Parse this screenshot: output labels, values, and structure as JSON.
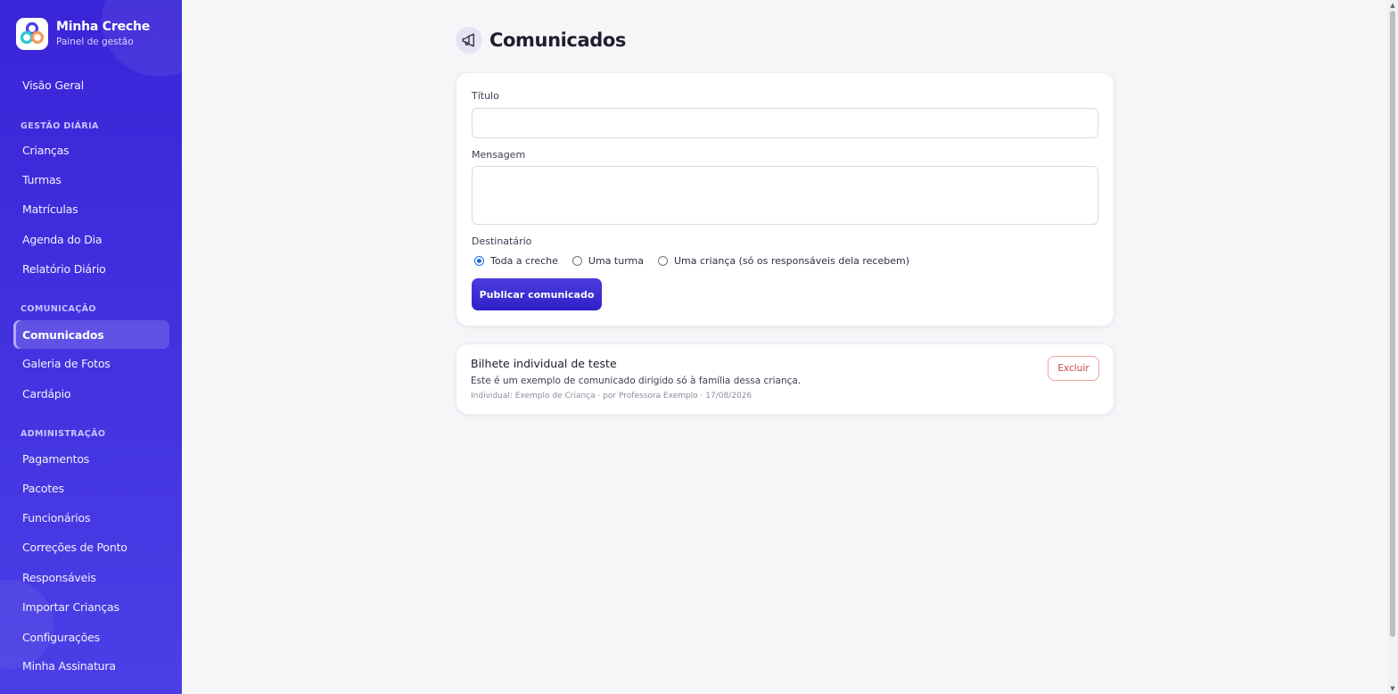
{
  "app": {
    "title": "Minha Creche",
    "subtitle": "Painel de gestão",
    "colors": {
      "sidebar": "#3a24d8",
      "accent": "#2f20c7",
      "danger": "#d2453a"
    }
  },
  "sidebar": {
    "overview": "Visão Geral",
    "sections": [
      {
        "title": "GESTÃO DIÁRIA",
        "items": [
          "Crianças",
          "Turmas",
          "Matrículas",
          "Agenda do Dia",
          "Relatório Diário"
        ]
      },
      {
        "title": "COMUNICAÇÃO",
        "items": [
          "Comunicados",
          "Galeria de Fotos",
          "Cardápio"
        ]
      },
      {
        "title": "ADMINISTRAÇÃO",
        "items": [
          "Pagamentos",
          "Pacotes",
          "Funcionários",
          "Correções de Ponto",
          "Responsáveis",
          "Importar Crianças",
          "Configurações",
          "Minha Assinatura"
        ]
      }
    ],
    "active": "Comunicados"
  },
  "header": {
    "title": "Comunicados",
    "icon": "megaphone-icon"
  },
  "form": {
    "title_label": "Título",
    "title_value": "",
    "message_label": "Mensagem",
    "message_value": "",
    "recipient_label": "Destinatário",
    "recipient_options": [
      "Toda a creche",
      "Uma turma",
      "Uma criança (só os responsáveis dela recebem)"
    ],
    "recipient_selected": "Toda a creche",
    "submit_label": "Publicar comunicado"
  },
  "announcements": [
    {
      "title": "Bilhete individual de teste",
      "body": "Este é um exemplo de comunicado dirigido só à família dessa criança.",
      "meta": "Individual: Exemplo de Criança · por Professora Exemplo · 17/08/2026",
      "delete_label": "Excluir"
    }
  ]
}
